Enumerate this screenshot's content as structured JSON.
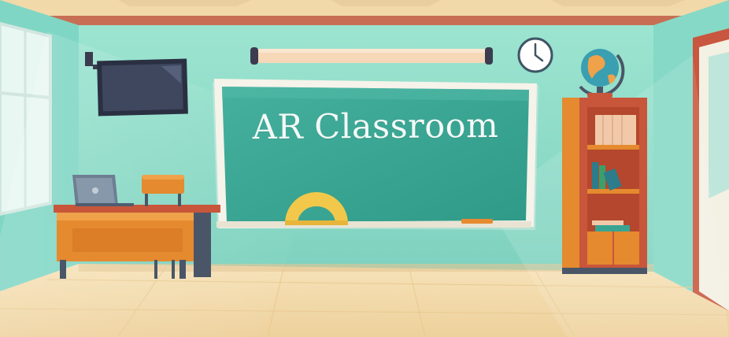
{
  "board": {
    "title": "AR Classroom"
  },
  "colors": {
    "wall": "#8fe0cc",
    "chalkboard": "#3aa493",
    "floor": "#f2dcae",
    "wood": "#b4472d",
    "accent_orange": "#e58a2e"
  },
  "icons": [
    "wall-clock-icon",
    "globe-icon",
    "laptop-icon",
    "tv-monitor-icon",
    "protractor-icon"
  ]
}
